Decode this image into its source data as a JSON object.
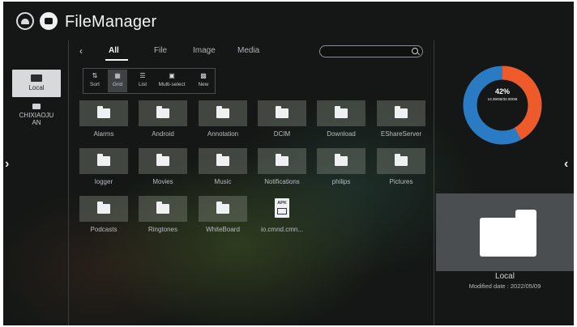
{
  "header": {
    "title": "FileManager",
    "back_icon": "back-circle-icon",
    "app_icon": "folder-circle-icon"
  },
  "sidebar": {
    "items": [
      {
        "label": "Local",
        "icon": "monitor-icon",
        "selected": true
      },
      {
        "label": "CHIXIAOJUAN",
        "icon": "usb-drive-icon",
        "selected": false
      }
    ]
  },
  "tabs": [
    {
      "label": "All",
      "active": true
    },
    {
      "label": "File",
      "active": false
    },
    {
      "label": "Image",
      "active": false
    },
    {
      "label": "Media",
      "active": false
    }
  ],
  "search": {
    "placeholder": ""
  },
  "toolbar": {
    "items": [
      {
        "label": "Sort",
        "icon": "sort-icon",
        "active": false
      },
      {
        "label": "Grid",
        "icon": "grid-icon",
        "active": true
      },
      {
        "label": "List",
        "icon": "list-icon",
        "active": false
      },
      {
        "label": "Multi-select",
        "icon": "multi-select-icon",
        "active": false
      },
      {
        "label": "New",
        "icon": "new-folder-icon",
        "active": false
      }
    ]
  },
  "files": [
    {
      "name": "Alarms",
      "type": "folder"
    },
    {
      "name": "Android",
      "type": "folder"
    },
    {
      "name": "Annotation",
      "type": "folder"
    },
    {
      "name": "DCIM",
      "type": "folder"
    },
    {
      "name": "Download",
      "type": "folder"
    },
    {
      "name": "EShareServer",
      "type": "folder"
    },
    {
      "name": "logger",
      "type": "folder"
    },
    {
      "name": "Movies",
      "type": "folder"
    },
    {
      "name": "Music",
      "type": "folder"
    },
    {
      "name": "Notifications",
      "type": "folder"
    },
    {
      "name": "philips",
      "type": "folder"
    },
    {
      "name": "Pictures",
      "type": "folder"
    },
    {
      "name": "Podcasts",
      "type": "folder"
    },
    {
      "name": "Ringtones",
      "type": "folder"
    },
    {
      "name": "WhiteBoard",
      "type": "folder"
    },
    {
      "name": "io.cmnd.cmn...",
      "type": "apk",
      "badge": "APK"
    }
  ],
  "storage": {
    "percent_label": "42%",
    "used_total": "13.39GB/32.00GB",
    "used_fraction": 0.42,
    "used_color": "#ef5a2a",
    "free_color": "#2b7bc4"
  },
  "preview": {
    "name": "Local",
    "modified": "Modified date : 2022/05/09"
  }
}
